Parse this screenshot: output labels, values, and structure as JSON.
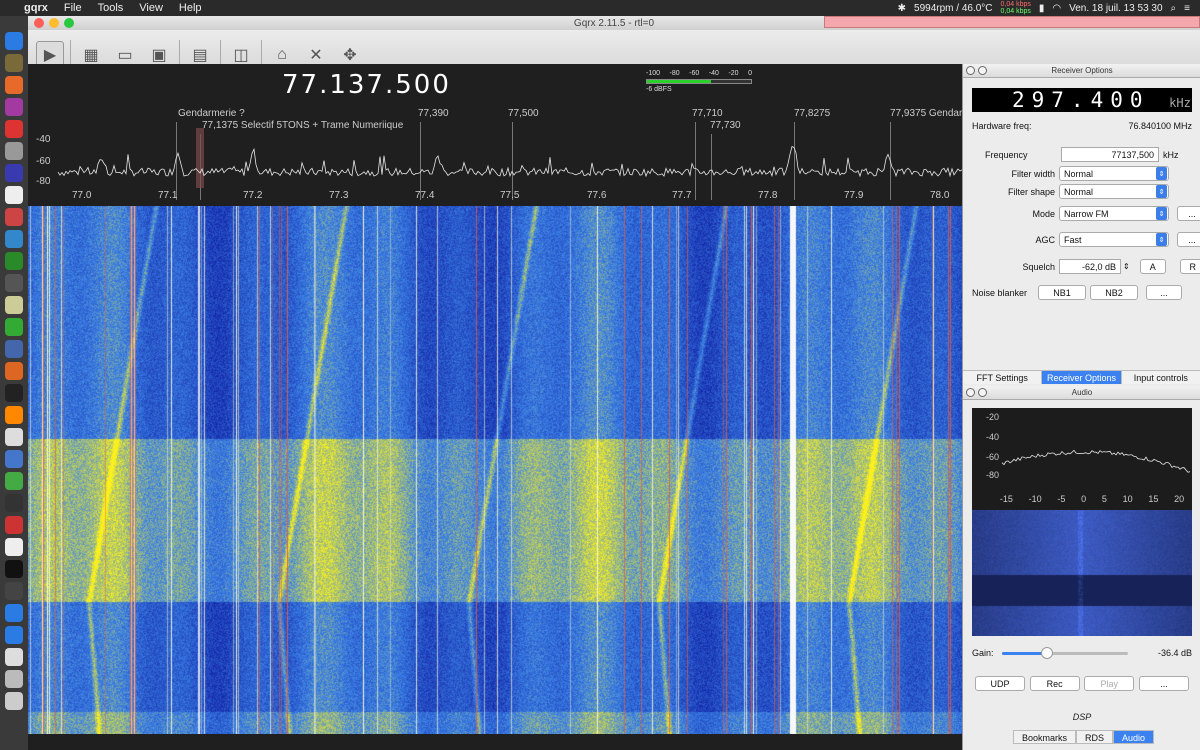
{
  "menubar": {
    "apple": "",
    "app_name": "gqrx",
    "items": [
      "File",
      "Tools",
      "View",
      "Help"
    ],
    "fan": "5994rpm / 46.0°C",
    "net_up": "0,04 kbps",
    "net_down": "0,04 kbps",
    "datetime": "Ven. 18 juil. 13 53 30"
  },
  "window": {
    "title": "Gqrx 2.11.5 - rtl=0"
  },
  "plotter": {
    "frequency": "77.137.500",
    "smeter_ticks": [
      "-100",
      "-80",
      "-60",
      "-40",
      "-20",
      "0"
    ],
    "smeter_label": "-6 dBFS",
    "smeter_level": 0.62,
    "bookmarks": [
      {
        "label": "Gendarmerie ?"
      },
      {
        "label": "77,1375 Selectif 5TONS + Trame Numeriique"
      },
      {
        "label": "77,390"
      },
      {
        "label": "77,500"
      },
      {
        "label": "77,710"
      },
      {
        "label": "77,730"
      },
      {
        "label": "77,8275"
      },
      {
        "label": "77,9375 Gendarmerie"
      }
    ],
    "db_labels": [
      "-40",
      "-60",
      "-80"
    ],
    "freq_axis": [
      "77.0",
      "77.1",
      "77.2",
      "77.3",
      "77.4",
      "77.5",
      "77.6",
      "77.7",
      "77.8",
      "77.9",
      "78.0"
    ]
  },
  "receiver": {
    "panel_title": "Receiver Options",
    "lcd_value": "297.400",
    "lcd_unit": "kHz",
    "hw_freq_label": "Hardware freq:",
    "hw_freq_value": "76.840100 MHz",
    "frequency_label": "Frequency",
    "frequency_value": "77137,500",
    "frequency_unit": "kHz",
    "filter_width_label": "Filter width",
    "filter_width_value": "Normal",
    "filter_shape_label": "Filter shape",
    "filter_shape_value": "Normal",
    "mode_label": "Mode",
    "mode_value": "Narrow FM",
    "agc_label": "AGC",
    "agc_value": "Fast",
    "squelch_label": "Squelch",
    "squelch_value": "-62,0 dB",
    "squelch_a": "A",
    "squelch_r": "R",
    "nb_label": "Noise blanker",
    "nb1": "NB1",
    "nb2": "NB2",
    "dots": "..."
  },
  "rx_tabs": [
    "FFT Settings",
    "Receiver Options",
    "Input controls"
  ],
  "audio": {
    "panel_title": "Audio",
    "db_labels": [
      "-20",
      "-40",
      "-60",
      "-80"
    ],
    "freq_axis": [
      "-15",
      "-10",
      "-5",
      "0",
      "5",
      "10",
      "15",
      "20"
    ],
    "gain_label": "Gain:",
    "gain_value": "-36.4 dB",
    "gain_level": 0.36,
    "udp": "UDP",
    "rec": "Rec",
    "play": "Play",
    "dots": "...",
    "dsp": "DSP"
  },
  "bottom_tabs": [
    "Bookmarks",
    "RDS",
    "Audio"
  ],
  "colors": {
    "accent": "#3b82f0",
    "waterfall_low": "#1530b8",
    "waterfall_high": "#f5f02a",
    "smeter_fill": "#2bd12b"
  }
}
